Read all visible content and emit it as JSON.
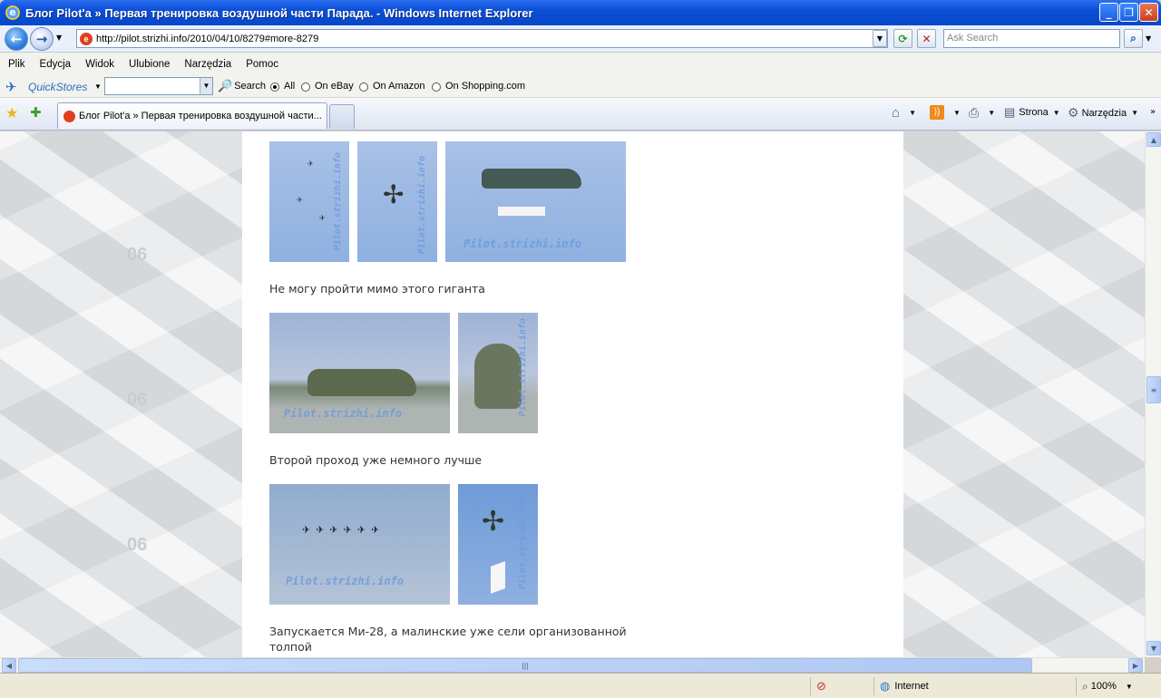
{
  "window": {
    "title": "Блог Pilot'a » Первая тренировка воздушной части Парада. - Windows Internet Explorer"
  },
  "address": {
    "url": "http://pilot.strizhi.info/2010/04/10/8279#more-8279",
    "search_placeholder": "Ask Search"
  },
  "menu": [
    "Plik",
    "Edycja",
    "Widok",
    "Ulubione",
    "Narzędzia",
    "Pomoc"
  ],
  "quickstores": {
    "label": "QuickStores",
    "search_label": "Search",
    "options": [
      {
        "label": "All",
        "selected": true
      },
      {
        "label": "On eBay",
        "selected": false
      },
      {
        "label": "On Amazon",
        "selected": false
      },
      {
        "label": "On Shopping.com",
        "selected": false
      }
    ]
  },
  "tabs": [
    {
      "label": "Блог Pilot'a » Первая тренировка воздушной части..."
    }
  ],
  "commandbar": {
    "page_label": "Strona",
    "tools_label": "Narzędzia"
  },
  "page": {
    "watermark": "Pilot.strizhi.info",
    "bg_mark": "06",
    "captions": [
      "Не могу пройти мимо этого гиганта",
      "Второй проход уже немного лучше",
      "Запускается Ми-28, а малинские уже сели организованной толпой"
    ]
  },
  "status": {
    "zone": "Internet",
    "zoom": "100%"
  },
  "colors": {
    "title_blue": "#0a4fd8",
    "link_text": "#333333"
  }
}
